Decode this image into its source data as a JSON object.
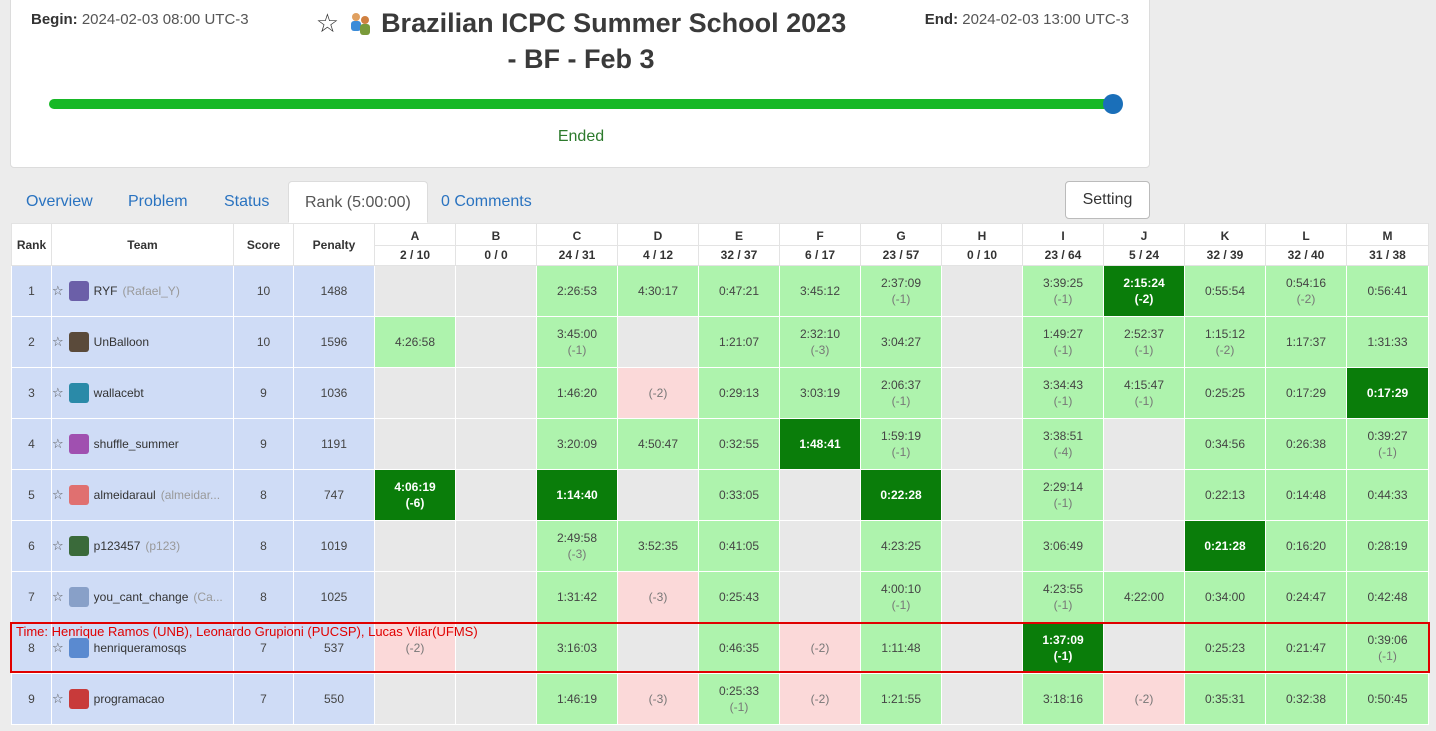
{
  "contest": {
    "begin_label": "Begin:",
    "begin_value": "2024-02-03 08:00 UTC-3",
    "end_label": "End:",
    "end_value": "2024-02-03 13:00 UTC-3",
    "title_line1": "Brazilian ICPC Summer School 2023",
    "title_line2": "- BF - Feb 3",
    "progress": 1.0,
    "status": "Ended"
  },
  "tabs": [
    "Overview",
    "Problem",
    "Status",
    "Rank (5:00:00)",
    "0 Comments"
  ],
  "setting_label": "Setting",
  "table": {
    "headers": {
      "rank": "Rank",
      "team": "Team",
      "score": "Score",
      "penalty": "Penalty"
    },
    "problems": [
      {
        "letter": "A",
        "stat": "2 / 10"
      },
      {
        "letter": "B",
        "stat": "0 / 0"
      },
      {
        "letter": "C",
        "stat": "24 / 31"
      },
      {
        "letter": "D",
        "stat": "4 / 12"
      },
      {
        "letter": "E",
        "stat": "32 / 37"
      },
      {
        "letter": "F",
        "stat": "6 / 17"
      },
      {
        "letter": "G",
        "stat": "23 / 57"
      },
      {
        "letter": "H",
        "stat": "0 / 10"
      },
      {
        "letter": "I",
        "stat": "23 / 64"
      },
      {
        "letter": "J",
        "stat": "5 / 24"
      },
      {
        "letter": "K",
        "stat": "32 / 39"
      },
      {
        "letter": "L",
        "stat": "32 / 40"
      },
      {
        "letter": "M",
        "stat": "31 / 38"
      }
    ],
    "rows": [
      {
        "rank": "1",
        "name": "RYF",
        "real": "(Rafael_Y)",
        "score": "10",
        "penalty": "1488",
        "cells": [
          {
            "s": "e"
          },
          {
            "s": "e"
          },
          {
            "s": "ok",
            "t": "2:26:53"
          },
          {
            "s": "ok",
            "t": "4:30:17"
          },
          {
            "s": "ok",
            "t": "0:47:21"
          },
          {
            "s": "ok",
            "t": "3:45:12"
          },
          {
            "s": "ok",
            "t": "2:37:09",
            "n": "(-1)"
          },
          {
            "s": "e"
          },
          {
            "s": "ok",
            "t": "3:39:25",
            "n": "(-1)"
          },
          {
            "s": "fb",
            "t": "2:15:24",
            "n": "(-2)"
          },
          {
            "s": "ok",
            "t": "0:55:54"
          },
          {
            "s": "ok",
            "t": "0:54:16",
            "n": "(-2)"
          },
          {
            "s": "ok",
            "t": "0:56:41"
          }
        ]
      },
      {
        "rank": "2",
        "name": "UnBalloon",
        "real": "",
        "score": "10",
        "penalty": "1596",
        "cells": [
          {
            "s": "ok",
            "t": "4:26:58"
          },
          {
            "s": "e"
          },
          {
            "s": "ok",
            "t": "3:45:00",
            "n": "(-1)"
          },
          {
            "s": "e"
          },
          {
            "s": "ok",
            "t": "1:21:07"
          },
          {
            "s": "ok",
            "t": "2:32:10",
            "n": "(-3)"
          },
          {
            "s": "ok",
            "t": "3:04:27"
          },
          {
            "s": "e"
          },
          {
            "s": "ok",
            "t": "1:49:27",
            "n": "(-1)"
          },
          {
            "s": "ok",
            "t": "2:52:37",
            "n": "(-1)"
          },
          {
            "s": "ok",
            "t": "1:15:12",
            "n": "(-2)"
          },
          {
            "s": "ok",
            "t": "1:17:37"
          },
          {
            "s": "ok",
            "t": "1:31:33"
          }
        ]
      },
      {
        "rank": "3",
        "name": "wallacebt",
        "real": "",
        "score": "9",
        "penalty": "1036",
        "cells": [
          {
            "s": "e"
          },
          {
            "s": "e"
          },
          {
            "s": "ok",
            "t": "1:46:20"
          },
          {
            "s": "x",
            "n": "(-2)"
          },
          {
            "s": "ok",
            "t": "0:29:13"
          },
          {
            "s": "ok",
            "t": "3:03:19"
          },
          {
            "s": "ok",
            "t": "2:06:37",
            "n": "(-1)"
          },
          {
            "s": "e"
          },
          {
            "s": "ok",
            "t": "3:34:43",
            "n": "(-1)"
          },
          {
            "s": "ok",
            "t": "4:15:47",
            "n": "(-1)"
          },
          {
            "s": "ok",
            "t": "0:25:25"
          },
          {
            "s": "ok",
            "t": "0:17:29"
          },
          {
            "s": "fb",
            "t": "0:17:29"
          }
        ]
      },
      {
        "rank": "4",
        "name": "shuffle_summer",
        "real": "",
        "score": "9",
        "penalty": "1191",
        "cells": [
          {
            "s": "e"
          },
          {
            "s": "e"
          },
          {
            "s": "ok",
            "t": "3:20:09"
          },
          {
            "s": "ok",
            "t": "4:50:47"
          },
          {
            "s": "ok",
            "t": "0:32:55"
          },
          {
            "s": "fb",
            "t": "1:48:41"
          },
          {
            "s": "ok",
            "t": "1:59:19",
            "n": "(-1)"
          },
          {
            "s": "e"
          },
          {
            "s": "ok",
            "t": "3:38:51",
            "n": "(-4)"
          },
          {
            "s": "e"
          },
          {
            "s": "ok",
            "t": "0:34:56"
          },
          {
            "s": "ok",
            "t": "0:26:38"
          },
          {
            "s": "ok",
            "t": "0:39:27",
            "n": "(-1)"
          }
        ]
      },
      {
        "rank": "5",
        "name": "almeidaraul",
        "real": "(almeidar...",
        "score": "8",
        "penalty": "747",
        "cells": [
          {
            "s": "fb",
            "t": "4:06:19",
            "n": "(-6)"
          },
          {
            "s": "e"
          },
          {
            "s": "fb",
            "t": "1:14:40"
          },
          {
            "s": "e"
          },
          {
            "s": "ok",
            "t": "0:33:05"
          },
          {
            "s": "e"
          },
          {
            "s": "fb",
            "t": "0:22:28"
          },
          {
            "s": "e"
          },
          {
            "s": "ok",
            "t": "2:29:14",
            "n": "(-1)"
          },
          {
            "s": "e"
          },
          {
            "s": "ok",
            "t": "0:22:13"
          },
          {
            "s": "ok",
            "t": "0:14:48"
          },
          {
            "s": "ok",
            "t": "0:44:33"
          }
        ]
      },
      {
        "rank": "6",
        "name": "p123457",
        "real": "(p123)",
        "score": "8",
        "penalty": "1019",
        "cells": [
          {
            "s": "e"
          },
          {
            "s": "e"
          },
          {
            "s": "ok",
            "t": "2:49:58",
            "n": "(-3)"
          },
          {
            "s": "ok",
            "t": "3:52:35"
          },
          {
            "s": "ok",
            "t": "0:41:05"
          },
          {
            "s": "e"
          },
          {
            "s": "ok",
            "t": "4:23:25"
          },
          {
            "s": "e"
          },
          {
            "s": "ok",
            "t": "3:06:49"
          },
          {
            "s": "e"
          },
          {
            "s": "fb",
            "t": "0:21:28"
          },
          {
            "s": "ok",
            "t": "0:16:20"
          },
          {
            "s": "ok",
            "t": "0:28:19"
          }
        ]
      },
      {
        "rank": "7",
        "name": "you_cant_change",
        "real": "(Ca...",
        "score": "8",
        "penalty": "1025",
        "cells": [
          {
            "s": "e"
          },
          {
            "s": "e"
          },
          {
            "s": "ok",
            "t": "1:31:42"
          },
          {
            "s": "x",
            "n": "(-3)"
          },
          {
            "s": "ok",
            "t": "0:25:43"
          },
          {
            "s": "e"
          },
          {
            "s": "ok",
            "t": "4:00:10",
            "n": "(-1)"
          },
          {
            "s": "e"
          },
          {
            "s": "ok",
            "t": "4:23:55",
            "n": "(-1)"
          },
          {
            "s": "ok",
            "t": "4:22:00"
          },
          {
            "s": "ok",
            "t": "0:34:00"
          },
          {
            "s": "ok",
            "t": "0:24:47"
          },
          {
            "s": "ok",
            "t": "0:42:48"
          }
        ]
      },
      {
        "rank": "8",
        "name": "henriqueramosqs",
        "real": "",
        "score": "7",
        "penalty": "537",
        "cells": [
          {
            "s": "x",
            "n": "(-2)"
          },
          {
            "s": "e"
          },
          {
            "s": "ok",
            "t": "3:16:03"
          },
          {
            "s": "e"
          },
          {
            "s": "ok",
            "t": "0:46:35"
          },
          {
            "s": "x",
            "n": "(-2)"
          },
          {
            "s": "ok",
            "t": "1:11:48"
          },
          {
            "s": "e"
          },
          {
            "s": "fb",
            "t": "1:37:09",
            "n": "(-1)"
          },
          {
            "s": "e"
          },
          {
            "s": "ok",
            "t": "0:25:23"
          },
          {
            "s": "ok",
            "t": "0:21:47"
          },
          {
            "s": "ok",
            "t": "0:39:06",
            "n": "(-1)"
          }
        ]
      },
      {
        "rank": "9",
        "name": "programacao",
        "real": "",
        "score": "7",
        "penalty": "550",
        "cells": [
          {
            "s": "e"
          },
          {
            "s": "e"
          },
          {
            "s": "ok",
            "t": "1:46:19"
          },
          {
            "s": "x",
            "n": "(-3)"
          },
          {
            "s": "ok",
            "t": "0:25:33",
            "n": "(-1)"
          },
          {
            "s": "x",
            "n": "(-2)"
          },
          {
            "s": "ok",
            "t": "1:21:55"
          },
          {
            "s": "e"
          },
          {
            "s": "ok",
            "t": "3:18:16"
          },
          {
            "s": "x",
            "n": "(-2)"
          },
          {
            "s": "ok",
            "t": "0:35:31"
          },
          {
            "s": "ok",
            "t": "0:32:38"
          },
          {
            "s": "ok",
            "t": "0:50:45"
          }
        ]
      }
    ]
  },
  "highlight_label": "Time: Henrique Ramos (UNB), Leonardo Grupioni (PUCSP), Lucas Vilar(UFMS)",
  "colors": {
    "solved": "#aef3ad",
    "first_blood": "#0a7d0a",
    "failed": "#fbd9d9",
    "empty": "#e8e8e8",
    "team_col": "#cfdcf6",
    "progress": "#17b826",
    "highlight": "#e00000"
  }
}
